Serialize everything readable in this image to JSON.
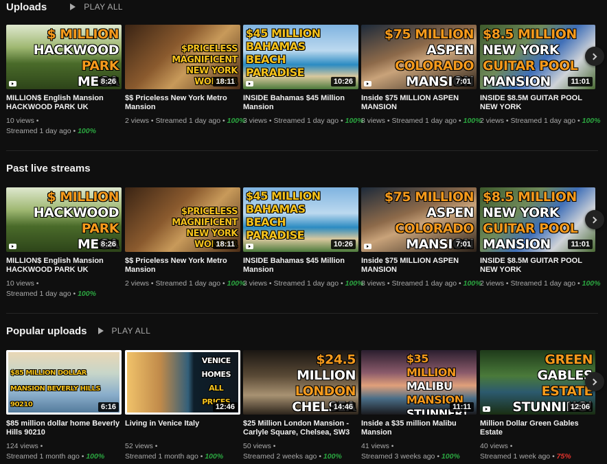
{
  "sections": [
    {
      "title": "Uploads",
      "play_all": "PLAY ALL",
      "videos": [
        {
          "thumb_lines": [
            "$ MILLION",
            "HACKWOOD",
            "PARK",
            "MEGA MANSION"
          ],
          "duration": "8:26",
          "title": "MILLION$ English Mansion HACKWOOD PARK UK",
          "views": "10 views",
          "streamed": "Streamed 1 day ago",
          "pct": "100%"
        },
        {
          "thumb_lines": [
            "$PRICELESS",
            "MAGNIFICENT",
            "NEW YORK",
            "WONDER"
          ],
          "duration": "18:11",
          "title": "$$ Priceless New York Metro Mansion",
          "views": "2 views",
          "streamed": "Streamed 1 day ago",
          "pct": "100%"
        },
        {
          "thumb_lines": [
            "$45 MILLION",
            "BAHAMAS",
            "BEACH",
            "PARADISE"
          ],
          "duration": "10:26",
          "title": "INSIDE Bahamas $45 Million Mansion",
          "views": "3 views",
          "streamed": "Streamed 1 day ago",
          "pct": "100%"
        },
        {
          "thumb_lines": [
            "$75 MILLION",
            "ASPEN",
            "COLORADO",
            "MANSION"
          ],
          "duration": "7:01",
          "title": "Inside $75 MILLION ASPEN MANSION",
          "views": "8 views",
          "streamed": "Streamed 1 day ago",
          "pct": "100%"
        },
        {
          "thumb_lines": [
            "$8.5 MILLION",
            "NEW YORK",
            "GUITAR POOL",
            "MANSION"
          ],
          "duration": "11:01",
          "title": "INSIDE $8.5M GUITAR POOL NEW YORK",
          "views": "2 views",
          "streamed": "Streamed 1 day ago",
          "pct": "100%"
        }
      ]
    },
    {
      "title": "Past live streams",
      "play_all": "",
      "videos": [
        {
          "thumb_lines": [
            "$ MILLION",
            "HACKWOOD",
            "PARK",
            "MEGA MANSION"
          ],
          "duration": "8:26",
          "title": "MILLION$ English Mansion HACKWOOD PARK UK",
          "views": "10 views",
          "streamed": "Streamed 1 day ago",
          "pct": "100%"
        },
        {
          "thumb_lines": [
            "$PRICELESS",
            "MAGNIFICENT",
            "NEW YORK",
            "WONDER"
          ],
          "duration": "18:11",
          "title": "$$ Priceless New York Metro Mansion",
          "views": "2 views",
          "streamed": "Streamed 1 day ago",
          "pct": "100%"
        },
        {
          "thumb_lines": [
            "$45 MILLION",
            "BAHAMAS",
            "BEACH",
            "PARADISE"
          ],
          "duration": "10:26",
          "title": "INSIDE Bahamas $45 Million Mansion",
          "views": "3 views",
          "streamed": "Streamed 1 day ago",
          "pct": "100%"
        },
        {
          "thumb_lines": [
            "$75 MILLION",
            "ASPEN",
            "COLORADO",
            "MANSION"
          ],
          "duration": "7:01",
          "title": "Inside $75 MILLION ASPEN MANSION",
          "views": "8 views",
          "streamed": "Streamed 1 day ago",
          "pct": "100%"
        },
        {
          "thumb_lines": [
            "$8.5 MILLION",
            "NEW YORK",
            "GUITAR POOL",
            "MANSION"
          ],
          "duration": "11:01",
          "title": "INSIDE $8.5M GUITAR POOL NEW YORK",
          "views": "2 views",
          "streamed": "Streamed 1 day ago",
          "pct": "100%"
        }
      ]
    },
    {
      "title": "Popular uploads",
      "play_all": "PLAY ALL",
      "videos": [
        {
          "thumb_lines": [
            "$85 MILLION DOLLAR",
            "MANSION BEVERLY HILLS 90210"
          ],
          "duration": "6:16",
          "title": "$85 million dollar home Beverly Hills 90210",
          "views": "124 views",
          "streamed": "Streamed 1 month ago",
          "pct": "100%"
        },
        {
          "thumb_lines": [
            "VENICE",
            "HOMES",
            "ALL",
            "PRICES"
          ],
          "duration": "12:46",
          "title": "Living in Venice Italy",
          "views": "52 views",
          "streamed": "Streamed 1 month ago",
          "pct": "100%"
        },
        {
          "thumb_lines": [
            "$24.5",
            "MILLION",
            "LONDON",
            "CHELSEA"
          ],
          "duration": "14:46",
          "title": "$25 Million London Mansion - Carlyle Square, Chelsea, SW3",
          "views": "50 views",
          "streamed": "Streamed 2 weeks ago",
          "pct": "100%"
        },
        {
          "thumb_lines": [
            "$35 MILLION",
            "MALIBU",
            "MANSION",
            "STUNNER!"
          ],
          "duration": "11:11",
          "title": "Inside a $35 million Malibu Mansion",
          "views": "41 views",
          "streamed": "Streamed 3 weeks ago",
          "pct": "100%"
        },
        {
          "thumb_lines": [
            "GREEN",
            "GABLES",
            "ESTATE",
            "STUNNING!"
          ],
          "duration": "12:06",
          "title": "Million Dollar Green Gables Estate",
          "views": "40 views",
          "streamed": "Streamed 1 week ago",
          "pct": "75%"
        }
      ]
    }
  ],
  "separator": " • "
}
